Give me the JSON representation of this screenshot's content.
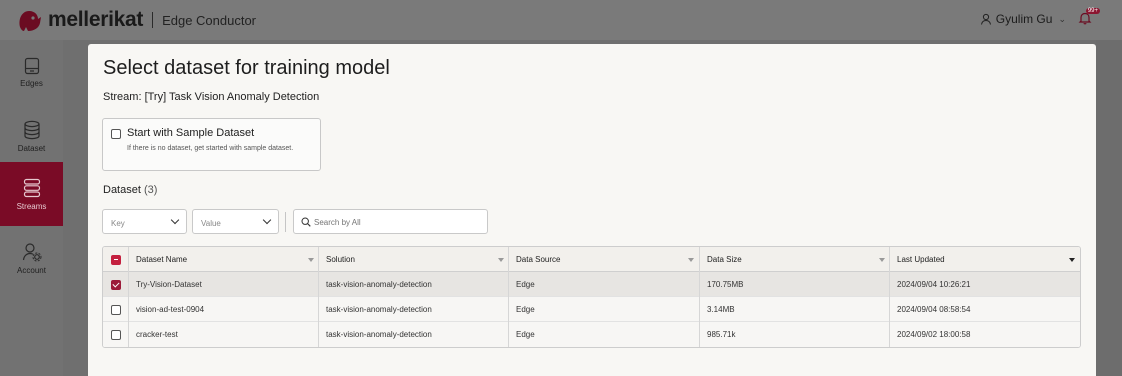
{
  "header": {
    "brand": "mellerikat",
    "app_name": "Edge Conductor",
    "user_name": "Gyulim Gu",
    "notification_badge": "99+"
  },
  "sidebar": {
    "items": [
      {
        "label": "Edges",
        "icon": "edge-device-icon",
        "active": false
      },
      {
        "label": "Dataset",
        "icon": "database-icon",
        "active": false
      },
      {
        "label": "Streams",
        "icon": "streams-icon",
        "active": true
      },
      {
        "label": "Account",
        "icon": "account-settings-icon",
        "active": false
      }
    ]
  },
  "modal": {
    "title": "Select dataset for training model",
    "stream": "Stream: [Try] Task Vision Anomaly Detection",
    "sample": {
      "checked": false,
      "title": "Start with Sample Dataset",
      "description": "If there is no dataset, get started with sample dataset."
    },
    "dataset_label": "Dataset",
    "dataset_count": "(3)",
    "filters": {
      "key_placeholder": "Key",
      "value_placeholder": "Value",
      "search_placeholder": "Search by All"
    },
    "table": {
      "columns": [
        "Dataset Name",
        "Solution",
        "Data Source",
        "Data Size",
        "Last Updated"
      ],
      "rows": [
        {
          "selected": true,
          "name": "Try-Vision-Dataset",
          "solution": "task-vision-anomaly-detection",
          "source": "Edge",
          "size": "170.75MB",
          "updated": "2024/09/04 10:26:21"
        },
        {
          "selected": false,
          "name": "vision-ad-test-0904",
          "solution": "task-vision-anomaly-detection",
          "source": "Edge",
          "size": "3.14MB",
          "updated": "2024/09/04 08:58:54"
        },
        {
          "selected": false,
          "name": "cracker-test",
          "solution": "task-vision-anomaly-detection",
          "source": "Edge",
          "size": "985.71k",
          "updated": "2024/09/02 18:00:58"
        }
      ]
    }
  },
  "colors": {
    "brand": "#9c1b3a",
    "sidebar_active": "#7a0b26",
    "overlay": "#6f6f6f"
  }
}
